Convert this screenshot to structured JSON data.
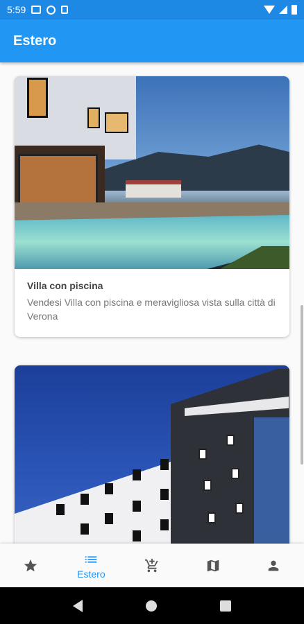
{
  "status_bar": {
    "time": "5:59",
    "icons": [
      "gallery-icon",
      "app-icon",
      "sd-card-icon"
    ],
    "right_icons": [
      "wifi-icon",
      "signal-icon",
      "battery-icon"
    ]
  },
  "app_bar": {
    "title": "Estero"
  },
  "cards": [
    {
      "title": "Villa con piscina",
      "description": "Vendesi Villa con piscina e meravigliosa vista sulla città di Verona",
      "image": "villa-pool-image"
    },
    {
      "title": "",
      "description": "",
      "image": "hotel-building-image"
    }
  ],
  "bottom_nav": {
    "items": [
      {
        "icon": "star-icon",
        "label": ""
      },
      {
        "icon": "list-icon",
        "label": "Estero",
        "active": true
      },
      {
        "icon": "cart-add-icon",
        "label": ""
      },
      {
        "icon": "map-icon",
        "label": ""
      },
      {
        "icon": "person-icon",
        "label": ""
      }
    ]
  },
  "colors": {
    "primary": "#2196f3",
    "status_bar": "#1e88e5"
  }
}
